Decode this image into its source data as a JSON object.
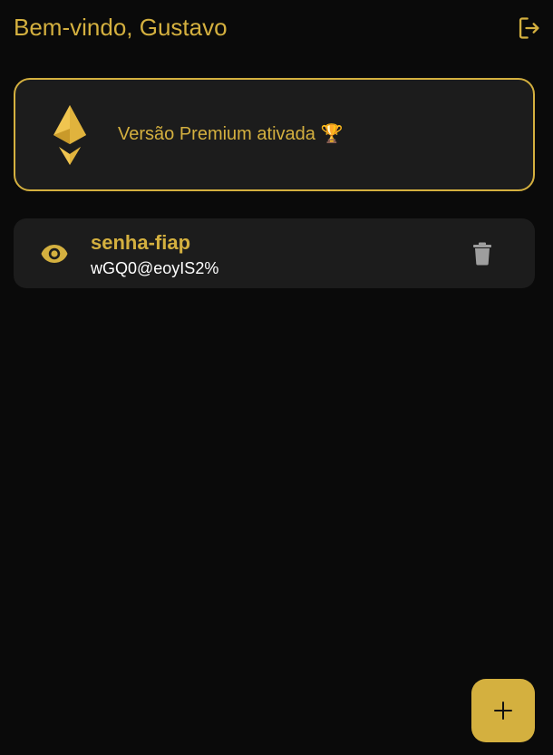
{
  "header": {
    "greeting": "Bem-vindo, Gustavo",
    "logout_icon": "logout-icon"
  },
  "premium": {
    "text": "Versão Premium ativada 🏆",
    "logo_icon": "ethereum-logo-icon"
  },
  "passwords": [
    {
      "name": "senha-fiap",
      "value": "wGQ0@eoyIS2%",
      "reveal_icon": "eye-icon",
      "delete_icon": "trash-icon"
    }
  ],
  "fab": {
    "label": "+",
    "icon": "plus-icon"
  },
  "colors": {
    "background": "#0a0a0a",
    "card": "#1c1c1c",
    "accent": "#d4b03f",
    "text_light": "#ffffff",
    "icon_gray": "#9e9e9e"
  }
}
